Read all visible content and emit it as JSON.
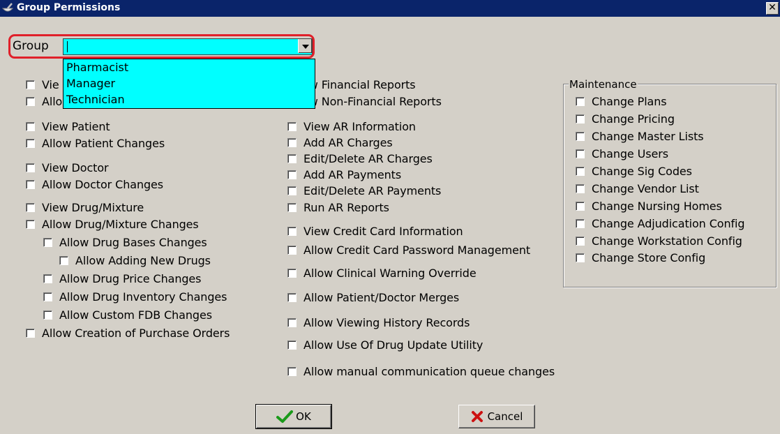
{
  "window": {
    "title": "Group Permissions",
    "close_glyph": "✕"
  },
  "group": {
    "label": "Group",
    "value": "",
    "options": [
      "Pharmacist",
      "Manager",
      "Technician"
    ]
  },
  "left_column": [
    "View Patient",
    "Allow Patient Changes",
    "View Doctor",
    "Allow Doctor Changes",
    "View Drug/Mixture",
    "Allow Drug/Mixture Changes",
    "Allow Drug Bases Changes",
    "Allow Adding New Drugs",
    "Allow Drug Price Changes",
    "Allow Drug Inventory Changes",
    "Allow Custom FDB Changes",
    "Allow Creation of Purchase Orders"
  ],
  "middle_column": [
    "ew Financial Reports",
    "ew Non-Financial Reports",
    "View AR Information",
    "Add AR Charges",
    "Edit/Delete AR Charges",
    "Add AR Payments",
    "Edit/Delete AR Payments",
    "Run AR Reports",
    "View Credit Card Information",
    "Allow Credit Card Password Management",
    "Allow Clinical Warning Override",
    "Allow Patient/Doctor  Merges",
    "Allow Viewing History Records",
    "Allow Use Of Drug Update Utility",
    "Allow manual communication queue changes"
  ],
  "partial_left": [
    "Vie",
    "Allo"
  ],
  "maintenance": {
    "title": "Maintenance",
    "items": [
      "Change Plans",
      "Change Pricing",
      "Change Master Lists",
      "Change Users",
      "Change Sig Codes",
      "Change Vendor List",
      "Change Nursing Homes",
      "Change Adjudication Config",
      "Change Workstation Config",
      "Change Store Config"
    ]
  },
  "buttons": {
    "ok": "OK",
    "cancel": "Cancel"
  },
  "colors": {
    "titlebar": "#0a246a",
    "combo_bg": "#00ffff",
    "highlight": "#e0202a",
    "ok_check": "#1a9a1a",
    "cancel_x": "#cc1111"
  },
  "icons": {
    "title": "mortar-pestle-icon",
    "ok": "checkmark-icon",
    "cancel": "x-icon",
    "dropdown": "chevron-down-icon"
  }
}
